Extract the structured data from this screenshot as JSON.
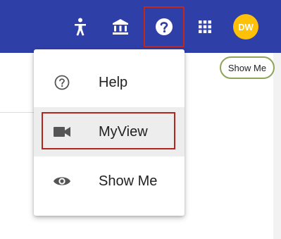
{
  "header": {
    "avatar_initials": "DW",
    "background": "#2f3fa8",
    "icons": [
      "accessibility-icon",
      "institution-icon",
      "help-icon",
      "apps-grid-icon"
    ]
  },
  "badge": {
    "label": "Show Me"
  },
  "help_menu": {
    "items": [
      {
        "icon": "help-circle-icon",
        "label": "Help"
      },
      {
        "icon": "video-camera-icon",
        "label": "MyView"
      },
      {
        "icon": "eye-icon",
        "label": "Show Me"
      }
    ]
  },
  "colors": {
    "highlight_border": "#b3261e",
    "avatar_bg": "#ffc107",
    "chip_border": "#8fa35a"
  }
}
